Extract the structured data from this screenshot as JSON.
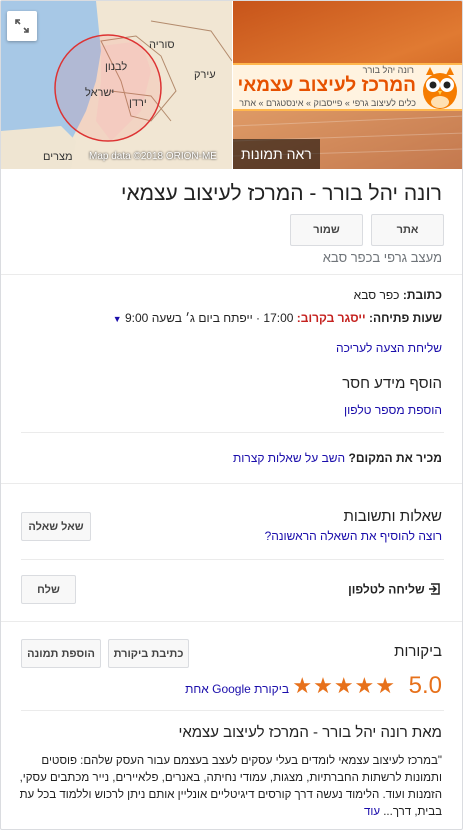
{
  "map": {
    "labels": {
      "syria": "סוריה",
      "lebanon": "לבנון",
      "israel": "ישראל",
      "jordan": "ירדן",
      "iraq": "עירק",
      "egypt": "מצרים"
    },
    "attribution": "Map data ©2018 ORION-ME"
  },
  "photo": {
    "banner_top": "רונה יהל בורר",
    "banner_title": "המרכז לעיצוב עצמאי",
    "banner_sub": "כלים לעיצוב גרפי » פייסבוק » אינסטגרם » אתר",
    "caption": "ראה תמונות"
  },
  "business": {
    "name": "רונה יהל בורר - המרכז לעיצוב עצמאי",
    "category": "מעצב גרפי בכפר סבא"
  },
  "actions": {
    "website": "אתר",
    "save": "שמור"
  },
  "info": {
    "address_label": "כתובת:",
    "address_value": "כפר סבא",
    "hours_label": "שעות פתיחה:",
    "hours_status": "ייסגר בקרוב:",
    "hours_close": "17:00",
    "hours_next": "· ייפתח ביום ג׳ בשעה 9:00",
    "suggest_edit": "שליחת הצעה לעריכה"
  },
  "missing_info": {
    "title": "הוסף מידע חסר",
    "add_phone": "הוספת מספר טלפון"
  },
  "know_place": {
    "label": "מכיר את המקום?",
    "link": "השב על שאלות קצרות"
  },
  "qa": {
    "title": "שאלות ותשובות",
    "prompt": "רוצה להוסיף את השאלה הראשונה?",
    "ask_button": "שאל שאלה"
  },
  "send_phone": {
    "label": "שליחה לטלפון",
    "button": "שלח"
  },
  "reviews": {
    "title": "ביקורות",
    "write_button": "כתיבת ביקורת",
    "add_photo_button": "הוספת תמונה",
    "score": "5.0",
    "stars": "★★★★★",
    "count_text": "ביקורת Google אחת"
  },
  "about": {
    "title": "מאת רונה יהל בורר - המרכז לעיצוב עצמאי",
    "text": "\"במרכז לעיצוב עצמאי לומדים בעלי עסקים לעצב בעצמם עבור העסק שלהם: פוסטים ותמונות לרשתות החברתיות, מצגות, עמודי נחיתה, באנרים, פלאיירים, נייר מכתבים עסקי, הזמנות ועוד. הלימוד נעשה דרך קורסים דיגיטליים אונליין אותם ניתן לרכוש וללמוד בכל עת בבית, דרך... ",
    "more": "עוד"
  },
  "colors": {
    "link": "#1a0dab",
    "accent_orange": "#e7711b",
    "closing_red": "#c5221f"
  }
}
